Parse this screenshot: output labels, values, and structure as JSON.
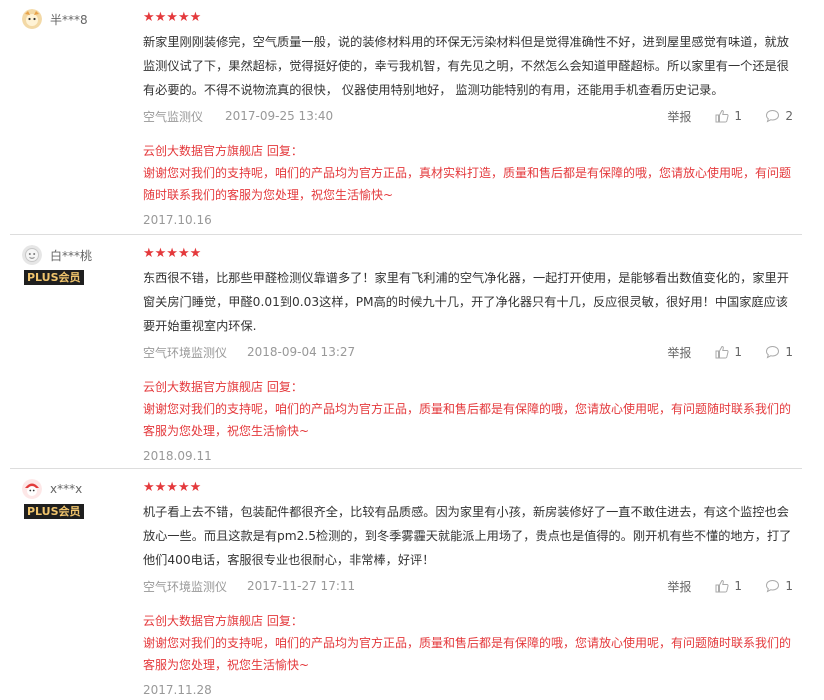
{
  "reviews": [
    {
      "username": "半***8",
      "plus": "",
      "stars": "★★★★★",
      "text": "新家里刚刚装修完，空气质量一般，说的装修材料用的环保无污染材料但是觉得准确性不好，进到屋里感觉有味道，就放监测仪试了下，果然超标，觉得挺好使的，幸亏我机智，有先见之明，不然怎么会知道甲醛超标。所以家里有一个还是很有必要的。不得不说物流真的很快， 仪器使用特别地好， 监测功能特别的有用，还能用手机查看历史记录。",
      "product": "空气监测仪",
      "date": "2017-09-25 13:40",
      "report": "举报",
      "likes": "1",
      "comments": "2",
      "reply_title": "云创大数据官方旗舰店 回复：",
      "reply_text": "谢谢您对我们的支持呢，咱们的产品均为官方正品，真材实料打造，质量和售后都是有保障的哦，您请放心使用呢，有问题随时联系我们的客服为您处理，祝您生活愉快~",
      "reply_date": "2017.10.16"
    },
    {
      "username": "白***桃",
      "plus": "PLUS会员",
      "stars": "★★★★★",
      "text": "东西很不错，比那些甲醛检测仪靠谱多了！家里有飞利浦的空气净化器，一起打开使用，是能够看出数值变化的，家里开窗关房门睡觉，甲醛0.01到0.03这样，PM高的时候九十几，开了净化器只有十几，反应很灵敏，很好用！中国家庭应该要开始重视室内环保.",
      "product": "空气环境监测仪",
      "date": "2018-09-04 13:27",
      "report": "举报",
      "likes": "1",
      "comments": "1",
      "reply_title": "云创大数据官方旗舰店 回复：",
      "reply_text": "谢谢您对我们的支持呢，咱们的产品均为官方正品，质量和售后都是有保障的哦，您请放心使用呢，有问题随时联系我们的客服为您处理，祝您生活愉快~",
      "reply_date": "2018.09.11"
    },
    {
      "username": "x***x",
      "plus": "PLUS会员",
      "stars": "★★★★★",
      "text": "机子看上去不错，包装配件都很齐全，比较有品质感。因为家里有小孩，新房装修好了一直不敢住进去，有这个监控也会放心一些。而且这款是有pm2.5检测的，到冬季雾霾天就能派上用场了，贵点也是值得的。刚开机有些不懂的地方，打了他们400电话，客服很专业也很耐心，非常棒，好评！",
      "product": "空气环境监测仪",
      "date": "2017-11-27 17:11",
      "report": "举报",
      "likes": "1",
      "comments": "1",
      "reply_title": "云创大数据官方旗舰店 回复：",
      "reply_text": "谢谢您对我们的支持呢，咱们的产品均为官方正品，质量和售后都是有保障的哦，您请放心使用呢，有问题随时联系我们的客服为您处理，祝您生活愉快~",
      "reply_date": "2017.11.28"
    }
  ]
}
